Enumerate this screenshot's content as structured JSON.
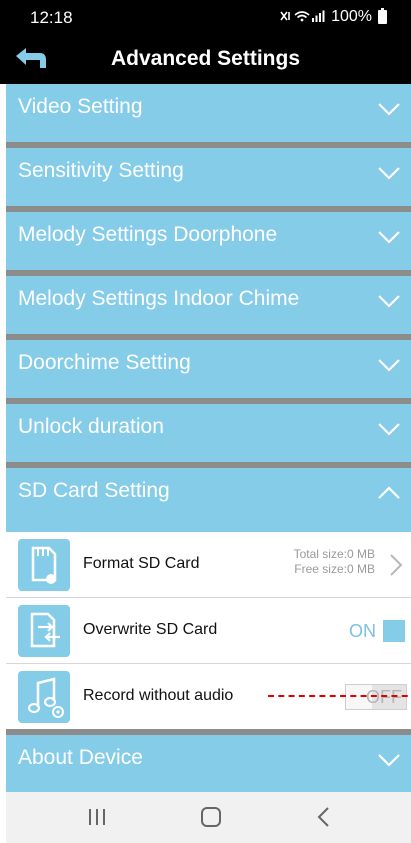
{
  "status_bar": {
    "time": "12:18",
    "signal_icons": "signal-wifi-icons",
    "battery_text": "100%"
  },
  "app_bar": {
    "title": "Advanced Settings",
    "back_icon": "back-arrow-icon"
  },
  "sections": {
    "video": {
      "label": "Video Setting"
    },
    "sensitivity": {
      "label": "Sensitivity Setting"
    },
    "melody_doorphone": {
      "label": "Melody Settings Doorphone"
    },
    "melody_chime": {
      "label": "Melody Settings Indoor Chime"
    },
    "doorchime": {
      "label": "Doorchime Setting"
    },
    "unlock": {
      "label": "Unlock duration"
    },
    "sd_card": {
      "label": "SD Card Setting",
      "expanded": true
    },
    "about": {
      "label": "About Device"
    }
  },
  "sd_card_rows": {
    "format": {
      "label": "Format SD Card",
      "total_size": "Total size:0 MB",
      "free_size": "Free size:0 MB",
      "icon": "sd-card-format-icon"
    },
    "overwrite": {
      "label": "Overwrite SD Card",
      "toggle_text": "ON",
      "icon": "overwrite-icon"
    },
    "record": {
      "label": "Record without audio",
      "toggle_text": "OFF",
      "icon": "music-settings-icon"
    }
  },
  "nav_bar": {
    "recents": "recents-icon",
    "home": "home-icon",
    "back": "back-icon"
  },
  "colors": {
    "header_bg": "#000000",
    "section_bg": "#85cce9",
    "divider": "#8c8c8c",
    "annotation_line": "#e00000"
  }
}
